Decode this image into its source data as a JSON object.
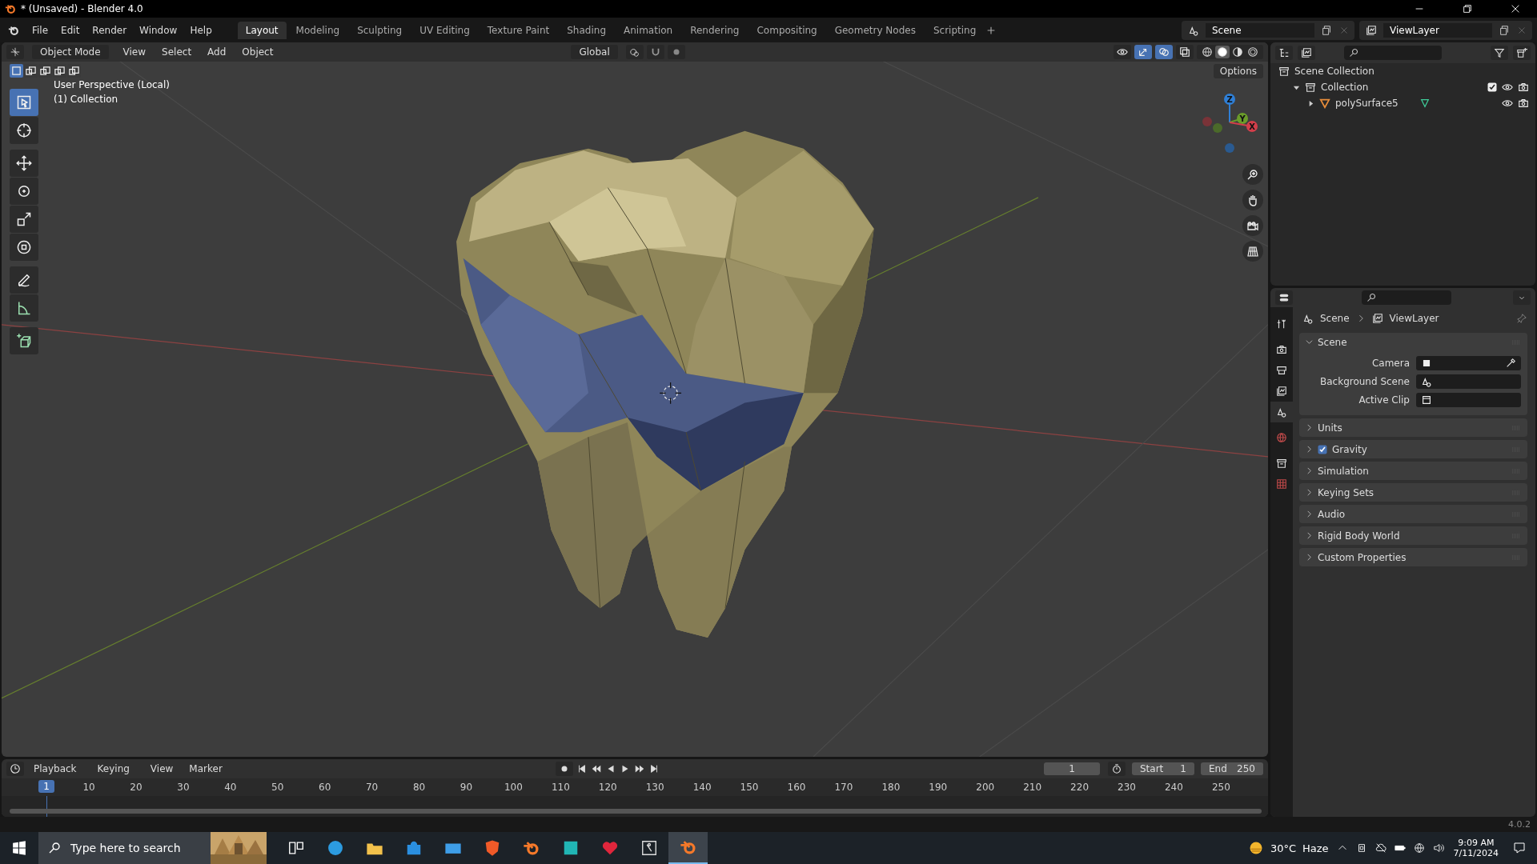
{
  "window": {
    "title": "* (Unsaved) - Blender 4.0"
  },
  "menu": [
    "File",
    "Edit",
    "Render",
    "Window",
    "Help"
  ],
  "workspaces": [
    {
      "label": "Layout",
      "selected": true
    },
    {
      "label": "Modeling",
      "selected": false
    },
    {
      "label": "Sculpting",
      "selected": false
    },
    {
      "label": "UV Editing",
      "selected": false
    },
    {
      "label": "Texture Paint",
      "selected": false
    },
    {
      "label": "Shading",
      "selected": false
    },
    {
      "label": "Animation",
      "selected": false
    },
    {
      "label": "Rendering",
      "selected": false
    },
    {
      "label": "Compositing",
      "selected": false
    },
    {
      "label": "Geometry Nodes",
      "selected": false
    },
    {
      "label": "Scripting",
      "selected": false
    }
  ],
  "scene": "Scene",
  "view_layer": "ViewLayer",
  "viewport": {
    "mode": "Object Mode",
    "menus": [
      "View",
      "Select",
      "Add",
      "Object"
    ],
    "orientation": "Global",
    "options": "Options",
    "select_modes": [
      {
        "kind": "set",
        "selected": true
      },
      {
        "kind": "extend",
        "selected": false
      },
      {
        "kind": "subtract",
        "selected": false
      },
      {
        "kind": "invert",
        "selected": false
      },
      {
        "kind": "intersect",
        "selected": false
      }
    ],
    "toggles": [
      {
        "kind": "visibility",
        "on": false
      },
      {
        "kind": "gizmo",
        "on": true
      },
      {
        "kind": "overlay",
        "on": true
      },
      {
        "kind": "xray",
        "on": false
      }
    ],
    "shading": [
      {
        "kind": "wireframe",
        "selected": false
      },
      {
        "kind": "solid",
        "selected": true
      },
      {
        "kind": "material",
        "selected": false
      },
      {
        "kind": "rendered",
        "selected": false
      }
    ],
    "overlay_text": [
      "User Perspective (Local)",
      "(1) Collection"
    ],
    "tools": [
      {
        "kind": "select",
        "selected": true
      },
      {
        "kind": "cursor",
        "selected": false
      },
      {
        "kind": "move",
        "selected": false
      },
      {
        "kind": "rotate",
        "selected": false
      },
      {
        "kind": "scale",
        "selected": false
      },
      {
        "kind": "transform",
        "selected": false
      },
      {
        "kind": "annotate",
        "selected": false
      },
      {
        "kind": "measure",
        "selected": false
      },
      {
        "kind": "add_cube",
        "selected": false
      }
    ],
    "axes": [
      "Z",
      "Y",
      "X"
    ]
  },
  "outliner": {
    "tree": [
      {
        "label": "Scene Collection",
        "kind": "scene_collection",
        "children": [
          {
            "label": "Collection",
            "kind": "collection",
            "expanded": true,
            "checked": true,
            "children": [
              {
                "label": "polySurface5",
                "kind": "object",
                "expanded": false
              }
            ]
          }
        ]
      }
    ]
  },
  "properties": {
    "tabs": [
      {
        "kind": "tool",
        "selected": false
      },
      {
        "kind": "render",
        "selected": false
      },
      {
        "kind": "output",
        "selected": false
      },
      {
        "kind": "view_layer",
        "selected": false
      },
      {
        "kind": "scene",
        "selected": true
      },
      {
        "kind": "world",
        "selected": false
      },
      {
        "kind": "collection",
        "selected": false
      },
      {
        "kind": "texture",
        "selected": false
      }
    ],
    "breadcrumb": [
      "Scene",
      "ViewLayer"
    ],
    "panels": [
      {
        "label": "Scene",
        "expanded": true,
        "fields": [
          {
            "label": "Camera",
            "kind": "camera"
          },
          {
            "label": "Background Scene",
            "kind": "scene"
          },
          {
            "label": "Active Clip",
            "kind": "clip"
          }
        ]
      },
      {
        "label": "Units",
        "expanded": false
      },
      {
        "label": "Gravity",
        "expanded": false,
        "checked": true
      },
      {
        "label": "Simulation",
        "expanded": false
      },
      {
        "label": "Keying Sets",
        "expanded": false
      },
      {
        "label": "Audio",
        "expanded": false
      },
      {
        "label": "Rigid Body World",
        "expanded": false
      },
      {
        "label": "Custom Properties",
        "expanded": false
      }
    ]
  },
  "timeline": {
    "menus": [
      "Playback",
      "Keying",
      "View",
      "Marker"
    ],
    "current_frame": "1",
    "start_label": "Start",
    "start": "1",
    "end_label": "End",
    "end": "250",
    "playhead": "1",
    "ticks": [
      "10",
      "20",
      "30",
      "40",
      "50",
      "60",
      "70",
      "80",
      "90",
      "100",
      "110",
      "120",
      "130",
      "140",
      "150",
      "160",
      "170",
      "180",
      "190",
      "200",
      "210",
      "220",
      "230",
      "240",
      "250"
    ]
  },
  "version": "4.0.2",
  "taskbar": {
    "search": {
      "placeholder": "Type here to search"
    },
    "apps": [
      {
        "kind": "taskview",
        "selected": false
      },
      {
        "kind": "edge",
        "selected": false
      },
      {
        "kind": "folder",
        "selected": false
      },
      {
        "kind": "store",
        "selected": false
      },
      {
        "kind": "mail",
        "selected": false
      },
      {
        "kind": "brave",
        "selected": false
      },
      {
        "kind": "blender",
        "selected": false
      },
      {
        "kind": "tile",
        "selected": false
      },
      {
        "kind": "heart",
        "selected": false
      },
      {
        "kind": "figure",
        "selected": false
      },
      {
        "kind": "blender",
        "selected": true
      }
    ],
    "weather": {
      "temp": "30°C",
      "condition": "Haze"
    },
    "time": "9:09 AM",
    "date": "7/11/2024"
  }
}
